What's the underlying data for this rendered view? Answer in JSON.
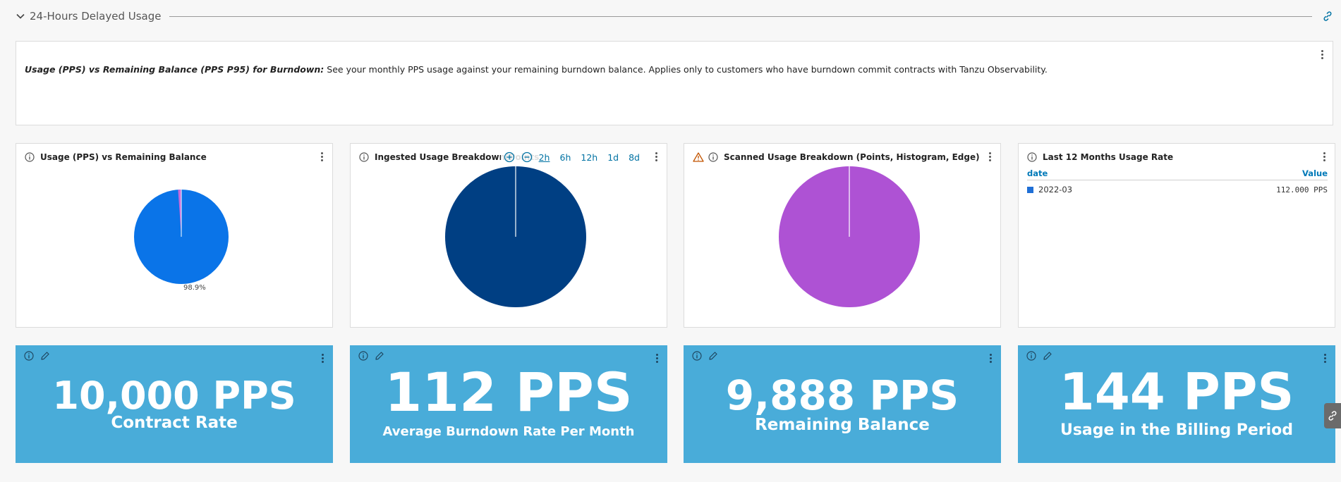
{
  "section": {
    "title": "24-Hours Delayed Usage"
  },
  "description": {
    "bold": "Usage (PPS) vs Remaining Balance (PPS P95) for Burndown:",
    "text": " See your monthly PPS usage against your remaining burndown balance. Applies only to customers who have burndown commit contracts with Tanzu Observability."
  },
  "charts": [
    {
      "title": "Usage (PPS) vs Remaining Balance",
      "pie_label": "98.9%",
      "colors": [
        "#0a74e8",
        "#c76bd9"
      ],
      "slices": [
        98.9,
        1.1
      ]
    },
    {
      "title": "Ingested Usage Breakdown(Points",
      "colors": [
        "#003f83"
      ],
      "zoom": {
        "ranges": [
          "2h",
          "6h",
          "12h",
          "1d",
          "8d"
        ],
        "active": "2h"
      }
    },
    {
      "title": "Scanned Usage Breakdown (Points, Histogram, Edge)",
      "colors": [
        "#ae52d4"
      ],
      "warning": true
    },
    {
      "title": "Last 12 Months Usage Rate",
      "table": {
        "headers": [
          "date",
          "Value"
        ],
        "rows": [
          {
            "date": "2022-03",
            "value": "112.000 PPS",
            "color": "#1f6fd6"
          }
        ]
      }
    }
  ],
  "stats": [
    {
      "value": "10,000 PPS",
      "label": "Contract Rate"
    },
    {
      "value": "112 PPS",
      "label": "Average Burndown Rate Per Month"
    },
    {
      "value": "9,888 PPS",
      "label": "Remaining Balance"
    },
    {
      "value": "144 PPS",
      "label": "Usage in the Billing Period"
    }
  ],
  "colors": {
    "stat_bg": "#49acd9",
    "link": "#0072a3"
  }
}
